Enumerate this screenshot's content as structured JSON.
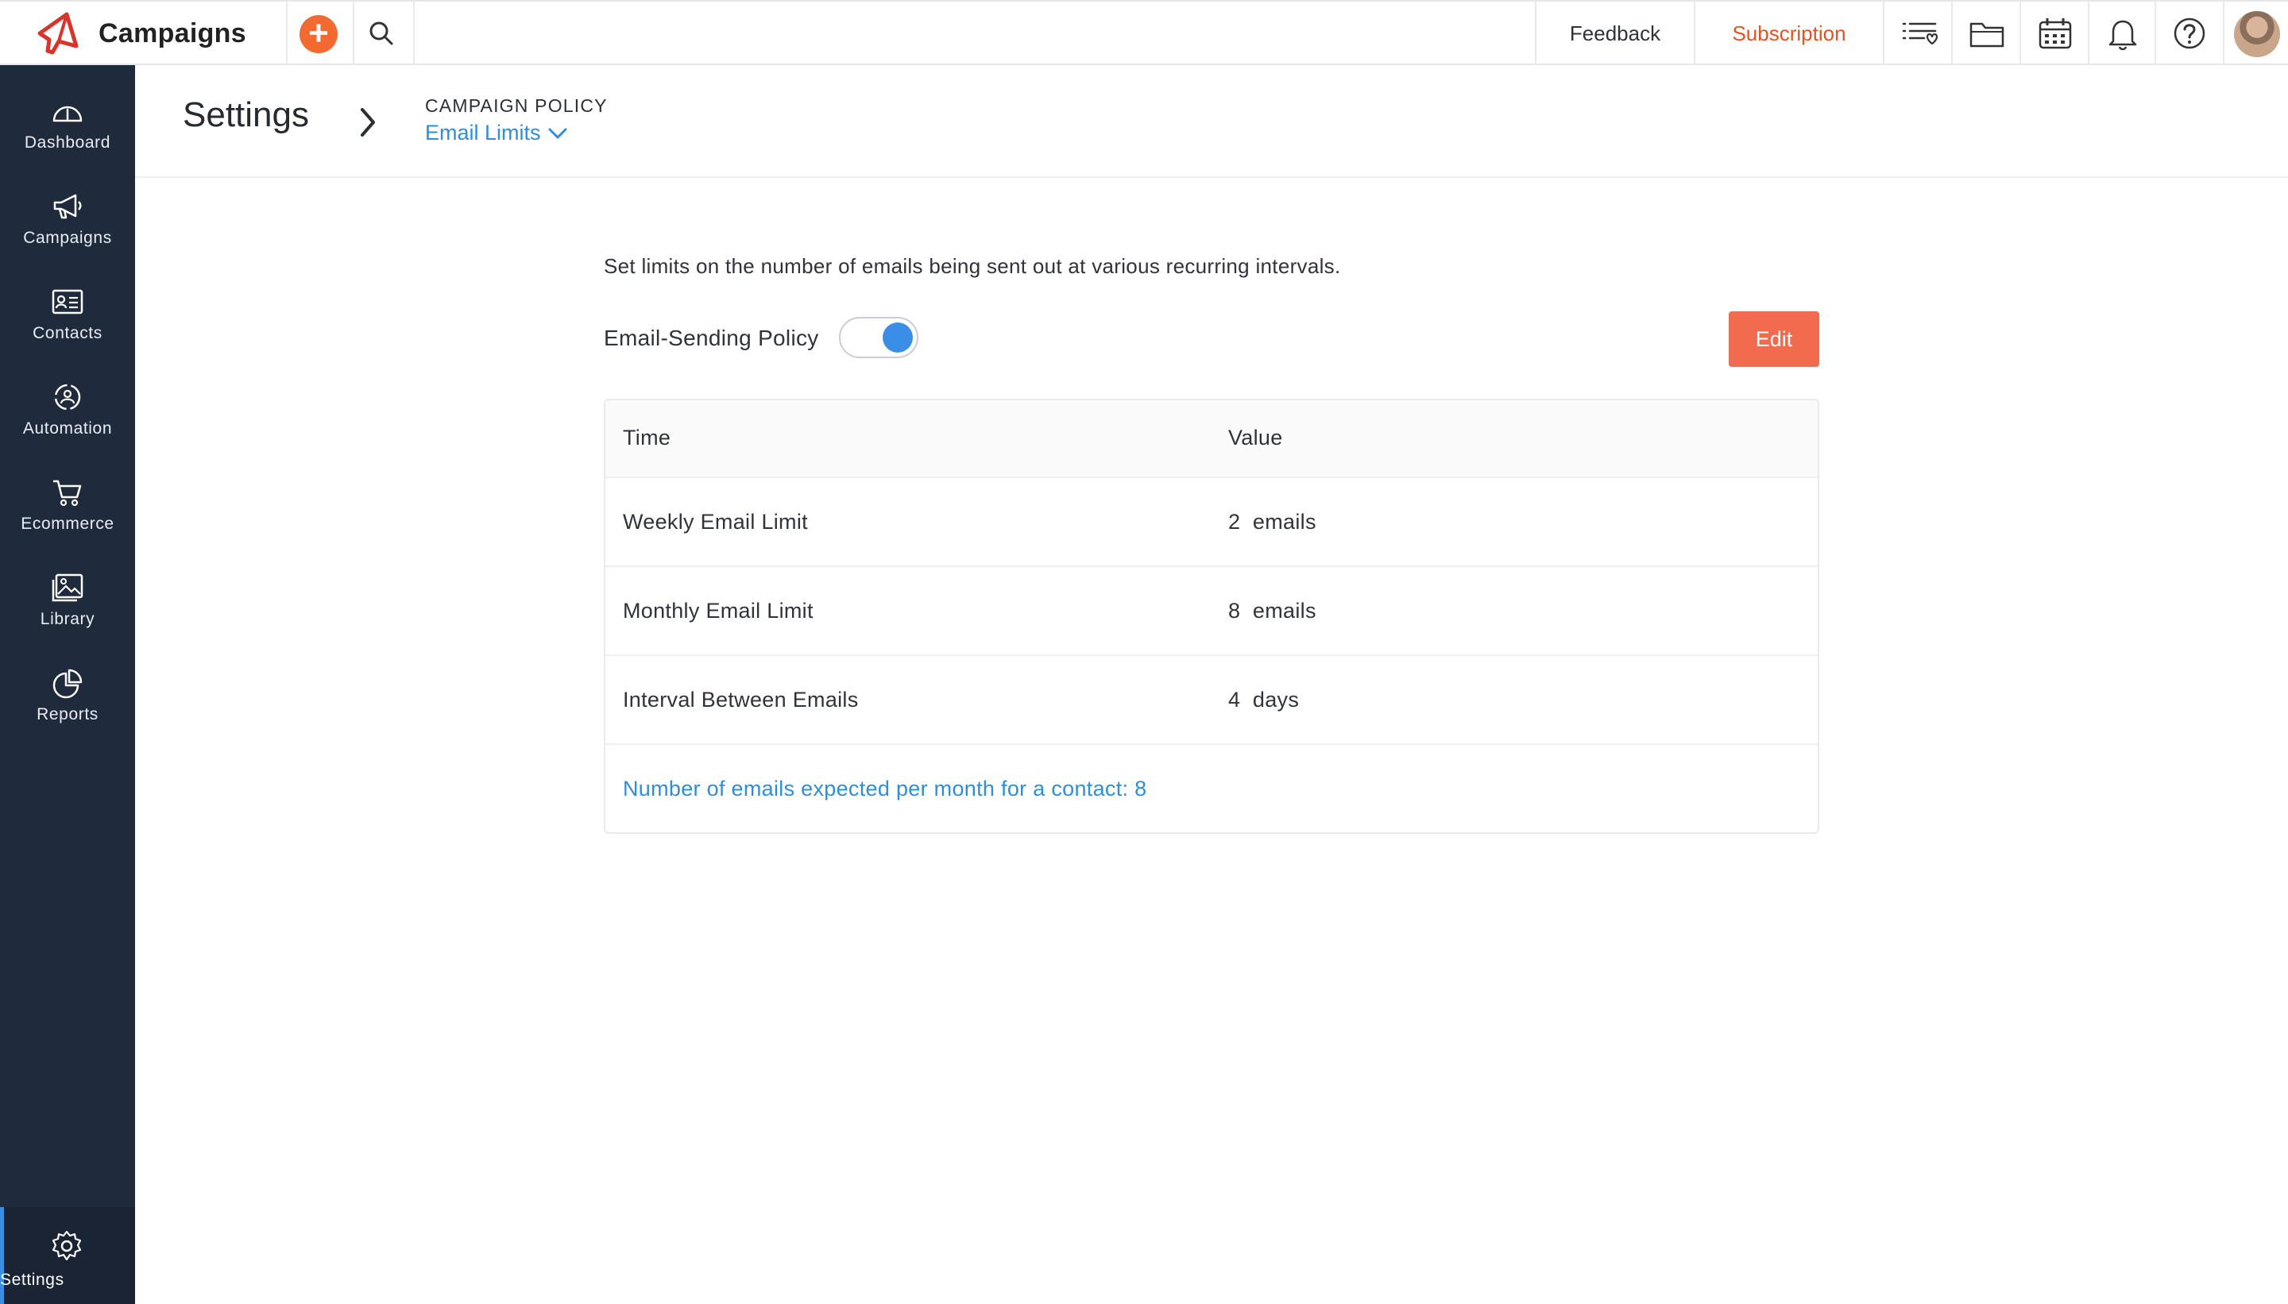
{
  "app": {
    "name": "Campaigns",
    "add_icon": "plus-icon",
    "search_icon": "search-icon"
  },
  "topbar": {
    "feedback_label": "Feedback",
    "subscription_label": "Subscription",
    "icons": [
      "list-filter-icon",
      "folder-icon",
      "calendar-icon",
      "bell-icon",
      "help-icon",
      "avatar"
    ],
    "subscription_color": "#e2531f"
  },
  "sidebar": {
    "items": [
      {
        "label": "Dashboard",
        "icon": "gauge-icon"
      },
      {
        "label": "Campaigns",
        "icon": "megaphone-icon"
      },
      {
        "label": "Contacts",
        "icon": "contact-card-icon"
      },
      {
        "label": "Automation",
        "icon": "automation-icon"
      },
      {
        "label": "Ecommerce",
        "icon": "cart-icon"
      },
      {
        "label": "Library",
        "icon": "image-library-icon"
      },
      {
        "label": "Reports",
        "icon": "pie-chart-icon"
      }
    ],
    "settings": {
      "label": "Settings",
      "icon": "gear-icon",
      "active": true
    },
    "background": "#1f2a3c"
  },
  "header": {
    "title": "Settings",
    "breadcrumb_section": "CAMPAIGN POLICY",
    "breadcrumb_current": "Email Limits"
  },
  "content": {
    "intro": "Set limits on the number of emails being sent out at various recurring intervals.",
    "policy_label": "Email-Sending Policy",
    "policy_enabled": true,
    "edit_label": "Edit",
    "edit_color": "#f26b4e",
    "table": {
      "headers": [
        "Time",
        "Value"
      ],
      "rows": [
        {
          "time": "Weekly Email Limit",
          "value": "2  emails"
        },
        {
          "time": "Monthly Email Limit",
          "value": "8  emails"
        },
        {
          "time": "Interval Between Emails",
          "value": "4  days"
        }
      ],
      "summary": "Number of emails expected per month for a contact: 8"
    }
  }
}
